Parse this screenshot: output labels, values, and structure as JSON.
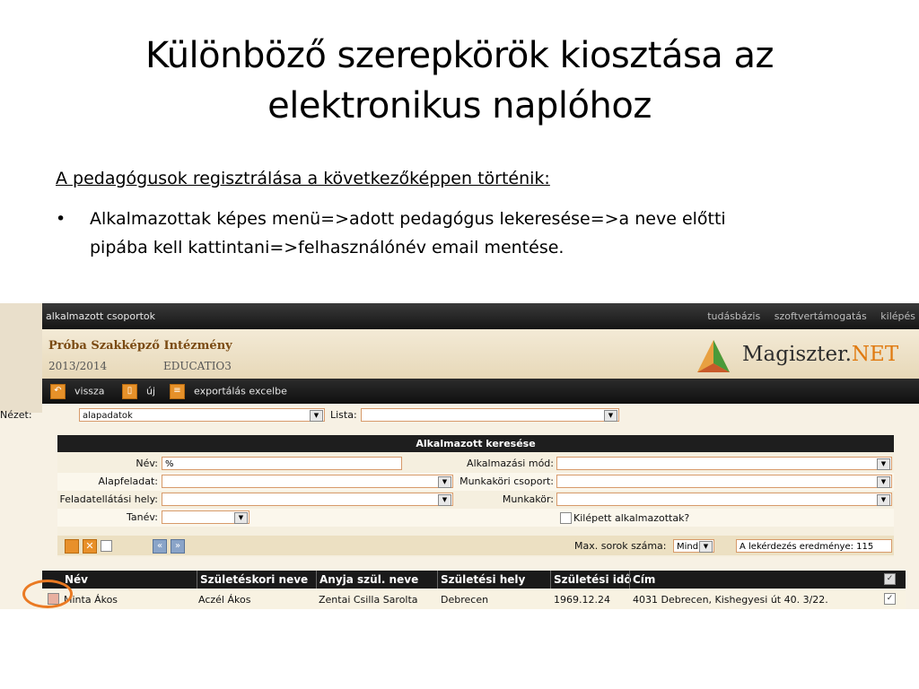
{
  "slide": {
    "title_line1": "Különböző szerepkörök kiosztása az",
    "title_line2": "elektronikus naplóhoz",
    "subtitle": "A pedagógusok regisztrálása a következőképpen történik:",
    "bullet_line1": "Alkalmazottak képes menü=>adott pedagógus lekeresése=>a neve előtti",
    "bullet_line2": "pipába kell kattintani=>felhasználónév email mentése."
  },
  "app": {
    "topbar_group": "alkalmazott csoportok",
    "topbar_links": [
      "tudásbázis",
      "szoftvertámogatás",
      "kilépés"
    ],
    "institution": "Próba Szakképző Intézmény",
    "year": "2013/2014",
    "edu": "EDUCATIO3",
    "brand_main": "Magiszter.",
    "brand_net": "NET",
    "toolbar": {
      "back": "vissza",
      "new": "új",
      "export": "exportálás excelbe"
    },
    "view_label": "Nézet:",
    "view_value": "alapadatok",
    "list_label": "Lista:",
    "list_value": ""
  },
  "search": {
    "title": "Alkalmazott keresése",
    "nev_label": "Név:",
    "nev_value": "%",
    "alapfeladat_label": "Alapfeladat:",
    "feladatellatasi_label": "Feladatellátási hely:",
    "tanev_label": "Tanév:",
    "alkalmazasi_label": "Alkalmazási mód:",
    "munkakori_csoport_label": "Munkaköri csoport:",
    "munkakor_label": "Munkakör:",
    "kilepett_label": "Kilépett alkalmazottak?",
    "max_rows_label": "Max. sorok száma:",
    "max_rows_value": "Mind",
    "result_label": "A lekérdezés eredménye: 115"
  },
  "table": {
    "columns": [
      "Név",
      "Születéskori neve",
      "Anyja szül. neve",
      "Születési hely",
      "Születési idő",
      "Cím"
    ],
    "rows": [
      [
        "Minta Ákos",
        "Aczél Ákos",
        "Zentai Csilla Sarolta",
        "Debrecen",
        "1969.12.24",
        "4031 Debrecen, Kishegyesi út 40. 3/22."
      ]
    ]
  },
  "colors": {
    "accent": "#e07a10",
    "highlight_circle": "#ea7a23",
    "dark_bar": "#151515"
  }
}
